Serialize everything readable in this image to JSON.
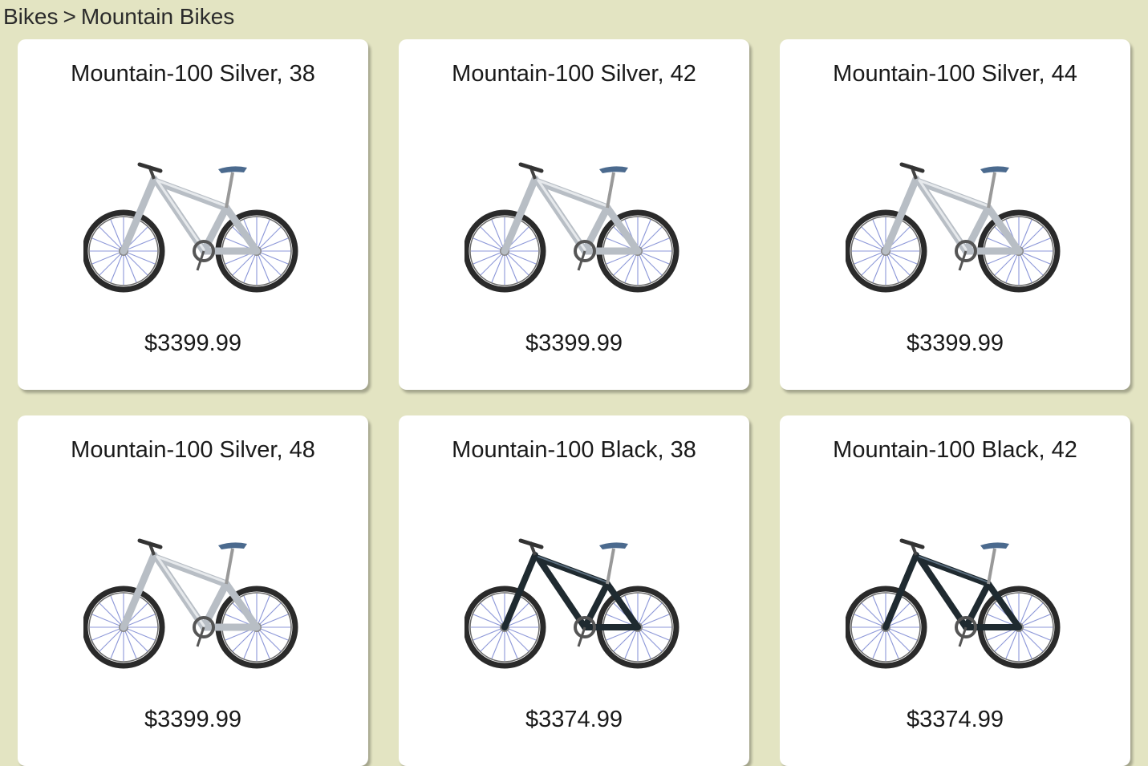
{
  "breadcrumb": {
    "root": "Bikes",
    "separator": ">",
    "current": "Mountain Bikes"
  },
  "colors": {
    "background": "#e3e4c2",
    "card": "#ffffff",
    "silver_frame": "#c9ced3",
    "black_frame": "#1f2a30",
    "tire": "#2a2a2a",
    "spokes": "#8c97d8"
  },
  "products": [
    {
      "name": "Mountain-100 Silver, 38",
      "price": "$3399.99",
      "image": "silver-mountain-bike-image"
    },
    {
      "name": "Mountain-100 Silver, 42",
      "price": "$3399.99",
      "image": "silver-mountain-bike-image"
    },
    {
      "name": "Mountain-100 Silver, 44",
      "price": "$3399.99",
      "image": "silver-mountain-bike-image"
    },
    {
      "name": "Mountain-100 Silver, 48",
      "price": "$3399.99",
      "image": "silver-mountain-bike-image"
    },
    {
      "name": "Mountain-100 Black, 38",
      "price": "$3374.99",
      "image": "black-mountain-bike-image"
    },
    {
      "name": "Mountain-100 Black, 42",
      "price": "$3374.99",
      "image": "black-mountain-bike-image"
    }
  ]
}
